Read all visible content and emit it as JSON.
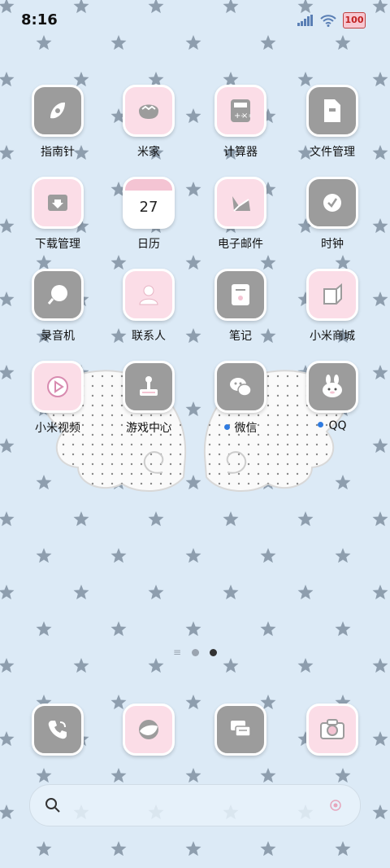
{
  "status": {
    "time": "8:16",
    "battery": "100"
  },
  "apps": [
    {
      "label": "指南针",
      "icon": "compass-icon",
      "theme": "gray"
    },
    {
      "label": "米家",
      "icon": "mi-home-icon",
      "theme": "pink"
    },
    {
      "label": "计算器",
      "icon": "calculator-icon",
      "theme": "pink"
    },
    {
      "label": "文件管理",
      "icon": "file-manager-icon",
      "theme": "gray"
    },
    {
      "label": "下载管理",
      "icon": "download-icon",
      "theme": "pink"
    },
    {
      "label": "日历",
      "icon": "calendar-icon",
      "theme": "gray",
      "calendar_day": "27"
    },
    {
      "label": "电子邮件",
      "icon": "email-icon",
      "theme": "pink"
    },
    {
      "label": "时钟",
      "icon": "clock-icon",
      "theme": "gray"
    },
    {
      "label": "录音机",
      "icon": "recorder-icon",
      "theme": "gray"
    },
    {
      "label": "联系人",
      "icon": "contacts-icon",
      "theme": "pink"
    },
    {
      "label": "笔记",
      "icon": "notes-icon",
      "theme": "gray"
    },
    {
      "label": "小米商城",
      "icon": "mi-store-icon",
      "theme": "pink"
    },
    {
      "label": "小米视频",
      "icon": "video-icon",
      "theme": "pink"
    },
    {
      "label": "游戏中心",
      "icon": "game-center-icon",
      "theme": "gray"
    },
    {
      "label": "微信",
      "icon": "wechat-icon",
      "theme": "gray",
      "badge": true
    },
    {
      "label": "QQ",
      "icon": "qq-icon",
      "theme": "gray",
      "badge": true
    }
  ],
  "dock": [
    {
      "icon": "phone-icon",
      "theme": "gray"
    },
    {
      "icon": "browser-icon",
      "theme": "pink"
    },
    {
      "icon": "messages-icon",
      "theme": "gray"
    },
    {
      "icon": "camera-icon",
      "theme": "pink"
    }
  ],
  "pager": {
    "count": 2,
    "active": 2
  },
  "colors": {
    "background": "#dceaf6",
    "star": "#8e9eae",
    "tile_gray": "#9c9c9c",
    "tile_pink": "#fbdde7",
    "badge": "#2f7be0"
  }
}
